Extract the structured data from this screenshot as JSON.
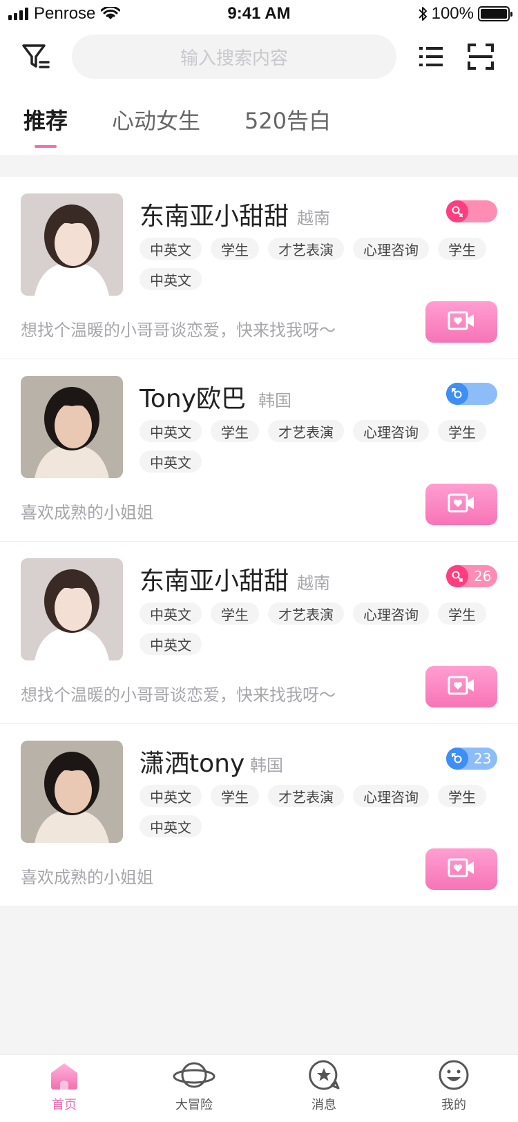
{
  "status_bar": {
    "carrier": "Penrose",
    "time": "9:41 AM",
    "battery": "100%"
  },
  "header": {
    "search_placeholder": "输入搜索内容"
  },
  "tabs": [
    {
      "label": "推荐",
      "active": true
    },
    {
      "label": "心动女生",
      "active": false
    },
    {
      "label": "520告白",
      "active": false
    }
  ],
  "users": [
    {
      "name": "东南亚小甜甜",
      "country": "越南",
      "gender": "female",
      "count": "",
      "tags": [
        "中英文",
        "学生",
        "才艺表演",
        "心理咨询",
        "学生",
        "中英文"
      ],
      "bio": "想找个温暖的小哥哥谈恋爱，快来找我呀～"
    },
    {
      "name": "Tony欧巴",
      "country": "韩国",
      "gender": "male",
      "count": "",
      "tags": [
        "中英文",
        "学生",
        "才艺表演",
        "心理咨询",
        "学生",
        "中英文"
      ],
      "bio": "喜欢成熟的小姐姐"
    },
    {
      "name": "东南亚小甜甜",
      "country": "越南",
      "gender": "female",
      "count": "26",
      "tags": [
        "中英文",
        "学生",
        "才艺表演",
        "心理咨询",
        "学生",
        "中英文"
      ],
      "bio": "想找个温暖的小哥哥谈恋爱，快来找我呀～"
    },
    {
      "name": "潇洒tony",
      "country": "韩国",
      "gender": "male",
      "count": "23",
      "tags": [
        "中英文",
        "学生",
        "才艺表演",
        "心理咨询",
        "学生",
        "中英文"
      ],
      "bio": "喜欢成熟的小姐姐"
    }
  ],
  "bottom_nav": [
    {
      "label": "首页",
      "icon": "home-icon",
      "active": true
    },
    {
      "label": "大冒险",
      "icon": "planet-icon",
      "active": false
    },
    {
      "label": "消息",
      "icon": "message-star-icon",
      "active": false
    },
    {
      "label": "我的",
      "icon": "smiley-icon",
      "active": false
    }
  ],
  "colors": {
    "accent": "#f26fb1",
    "female": "#ff3d7f",
    "female_light": "#ff8cb2",
    "male": "#3d8ef5",
    "male_light": "#8dbdf9"
  }
}
